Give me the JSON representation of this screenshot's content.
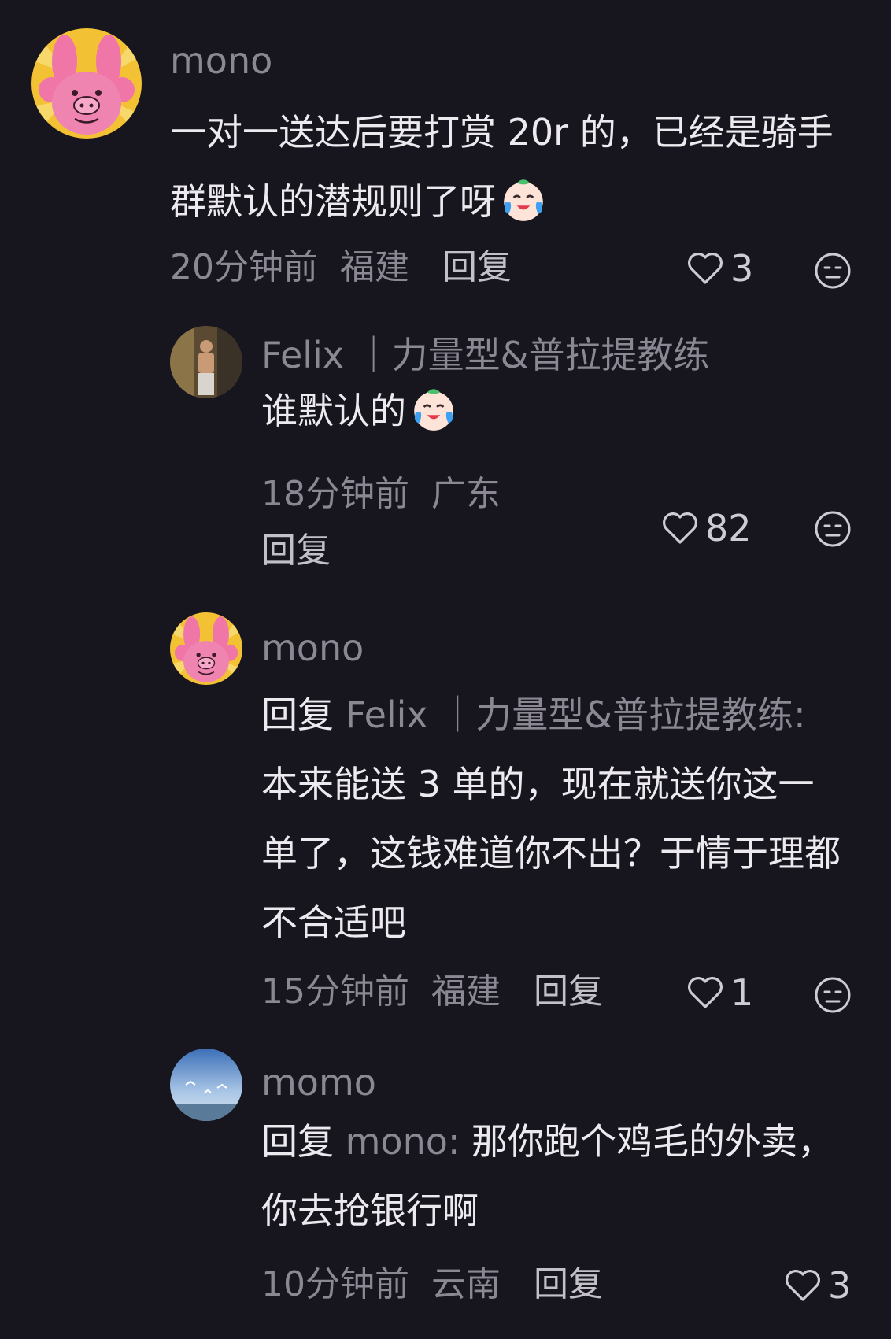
{
  "comments": [
    {
      "username": "mono",
      "content": "一对一送达后要打赏 20r 的，已经是骑手群默认的潜规则了呀",
      "time": "20分钟前",
      "region": "福建",
      "reply_label": "回复",
      "likes": "3",
      "emoji": "laughing-crying-emoji"
    },
    {
      "username": "Felix ｜力量型&普拉提教练",
      "content": "谁默认的",
      "time": "18分钟前",
      "region": "广东",
      "reply_label": "回复",
      "likes": "82",
      "emoji": "laughing-crying-emoji"
    },
    {
      "username": "mono",
      "reply_prefix": "回复",
      "reply_target": "Felix ｜力量型&普拉提教练:",
      "content": "本来能送 3 单的，现在就送你这一单了，这钱难道你不出？于情于理都不合适吧",
      "time": "15分钟前",
      "region": "福建",
      "reply_label": "回复",
      "likes": "1"
    },
    {
      "username": "momo",
      "reply_prefix": "回复",
      "reply_target": "mono:",
      "content": "那你跑个鸡毛的外卖，你去抢银行啊",
      "time": "10分钟前",
      "region": "云南",
      "reply_label": "回复",
      "likes": "3"
    }
  ],
  "icons": {
    "like": "heart-outline-icon",
    "dislike": "neutral-face-icon"
  },
  "colors": {
    "background": "#17161e",
    "text": "#ece9ef",
    "muted": "#8b8894"
  }
}
